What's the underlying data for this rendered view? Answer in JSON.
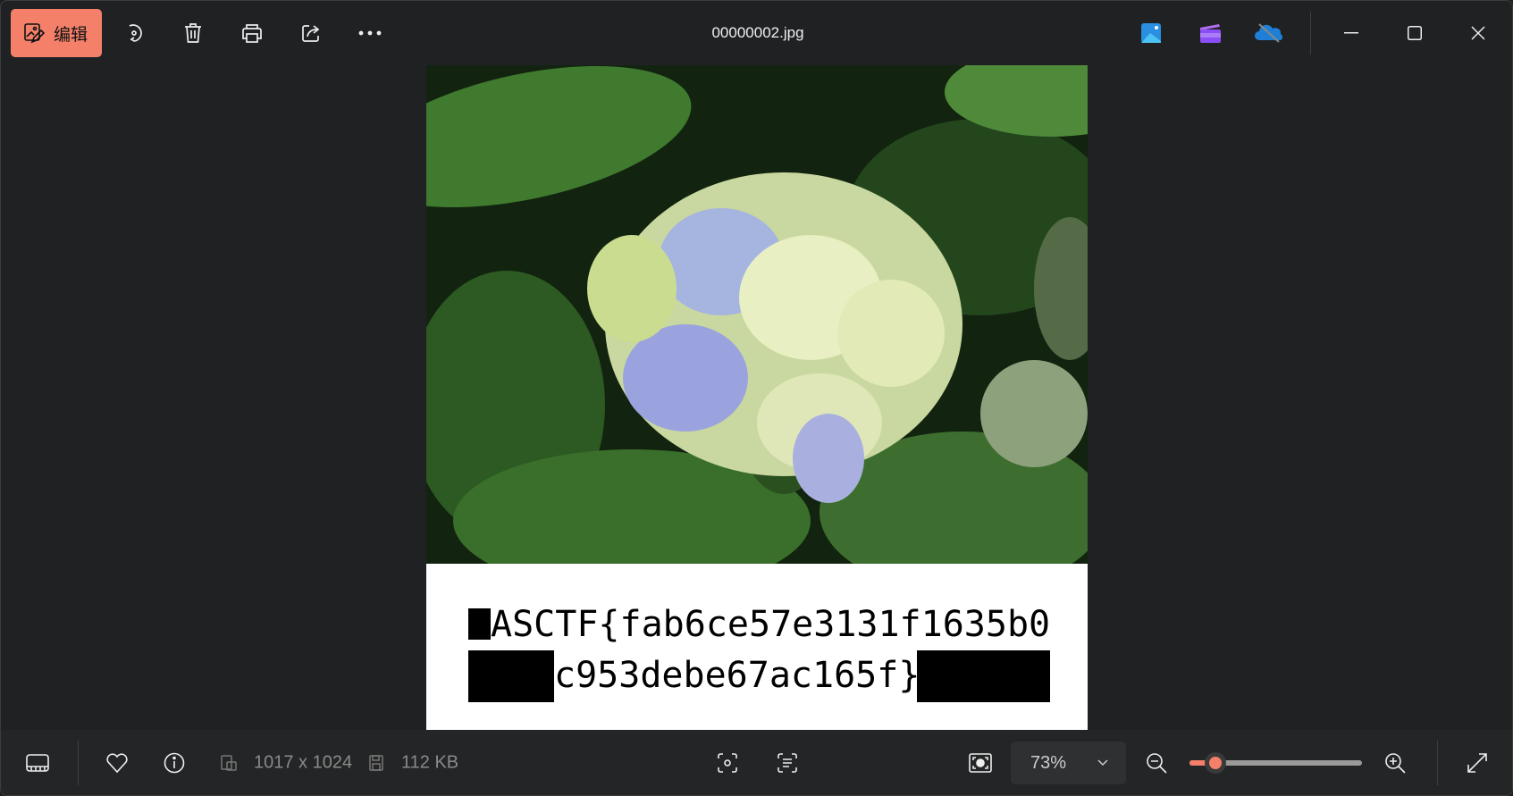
{
  "toolbar": {
    "edit_label": "编辑",
    "title": "00000002.jpg",
    "icons": [
      "edit-image-icon",
      "rotate-icon",
      "delete-icon",
      "print-icon",
      "share-icon",
      "more-icon",
      "photos-app-icon",
      "clipchamp-icon",
      "onedrive-offline-icon",
      "minimize-icon",
      "maximize-icon",
      "close-icon"
    ]
  },
  "image": {
    "flag_line1": "ASCTF{fab6ce57e3131f1635b0",
    "flag_line2": "c953debe67ac165f}"
  },
  "statusbar": {
    "dimensions": "1017 x 1024",
    "file_size": "112 KB",
    "zoom_value": "73%",
    "zoom_percent": 73,
    "slider_fraction": 0.15
  },
  "colors": {
    "accent": "#f4806a",
    "background": "#1f2123"
  }
}
